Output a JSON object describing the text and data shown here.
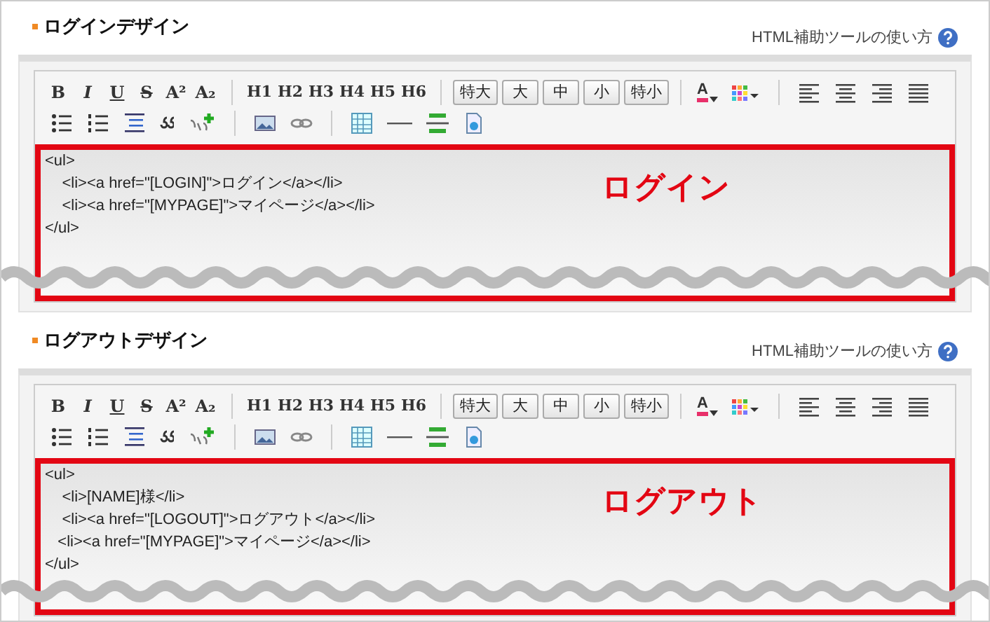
{
  "sections": [
    {
      "title": "ログインデザイン",
      "help_link": "HTML補助ツールの使い方",
      "toolbar": {
        "format_buttons": [
          {
            "kind": "bold",
            "label": "B"
          },
          {
            "kind": "italic",
            "label": "I"
          },
          {
            "kind": "underline",
            "label": "U"
          },
          {
            "kind": "strike",
            "label": "S"
          },
          {
            "kind": "sup",
            "label": "A²"
          },
          {
            "kind": "sub",
            "label": "A₂"
          }
        ],
        "heading_buttons": [
          "H1",
          "H2",
          "H3",
          "H4",
          "H5",
          "H6"
        ],
        "size_buttons": [
          "特大",
          "大",
          "中",
          "小",
          "特小"
        ],
        "font_color_label": "A"
      },
      "code_lines": [
        "<ul>",
        "\t<li><a href=\"[LOGIN]\">ログイン</a></li>",
        "\t<li><a href=\"[MYPAGE]\">マイページ</a></li>",
        "</ul>"
      ],
      "annotation": "ログイン"
    },
    {
      "title": "ログアウトデザイン",
      "help_link": "HTML補助ツールの使い方",
      "toolbar": {
        "format_buttons": [
          {
            "kind": "bold",
            "label": "B"
          },
          {
            "kind": "italic",
            "label": "I"
          },
          {
            "kind": "underline",
            "label": "U"
          },
          {
            "kind": "strike",
            "label": "S"
          },
          {
            "kind": "sup",
            "label": "A²"
          },
          {
            "kind": "sub",
            "label": "A₂"
          }
        ],
        "heading_buttons": [
          "H1",
          "H2",
          "H3",
          "H4",
          "H5",
          "H6"
        ],
        "size_buttons": [
          "特大",
          "大",
          "中",
          "小",
          "特小"
        ],
        "font_color_label": "A"
      },
      "code_lines": [
        "<ul>",
        "\t<li>[NAME]様</li>",
        "\t<li><a href=\"[LOGOUT]\">ログアウト</a></li>",
        "   <li><a href=\"[MYPAGE]\">マイページ</a></li>",
        "</ul>"
      ],
      "annotation": "ログアウト"
    }
  ]
}
